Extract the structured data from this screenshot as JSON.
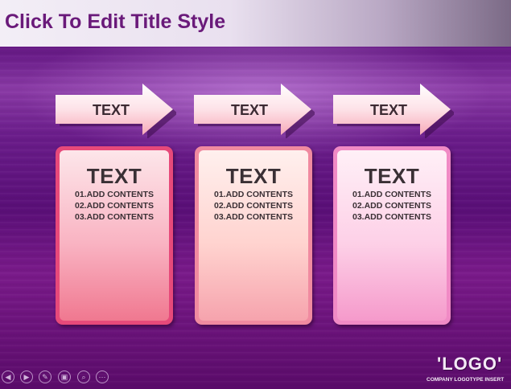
{
  "slide": {
    "title": "Click To Edit Title Style"
  },
  "columns": [
    {
      "arrow_label": "TEXT",
      "heading": "TEXT",
      "items": [
        "01.ADD CONTENTS",
        "02.ADD CONTENTS",
        "03.ADD CONTENTS"
      ]
    },
    {
      "arrow_label": "TEXT",
      "heading": "TEXT",
      "items": [
        "01.ADD CONTENTS",
        "02.ADD CONTENTS",
        "03.ADD CONTENTS"
      ]
    },
    {
      "arrow_label": "TEXT",
      "heading": "TEXT",
      "items": [
        "01.ADD CONTENTS",
        "02.ADD CONTENTS",
        "03.ADD CONTENTS"
      ]
    }
  ],
  "footer": {
    "logo": "'LOGO'",
    "logo_sub": "COMPANY LOGOTYPE INSERT"
  },
  "controls": [
    {
      "icon": "previous-icon",
      "glyph": "◀"
    },
    {
      "icon": "next-icon",
      "glyph": "▶"
    },
    {
      "icon": "pen-icon",
      "glyph": "✎"
    },
    {
      "icon": "slides-icon",
      "glyph": "▣"
    },
    {
      "icon": "zoom-icon",
      "glyph": "⌕"
    },
    {
      "icon": "more-icon",
      "glyph": "⋯"
    }
  ],
  "colors": {
    "title_text": "#6a1a7a",
    "background": "#5a0f70",
    "card1": "#e7497a",
    "card2": "#f08aa0",
    "card3": "#f08ac5"
  }
}
